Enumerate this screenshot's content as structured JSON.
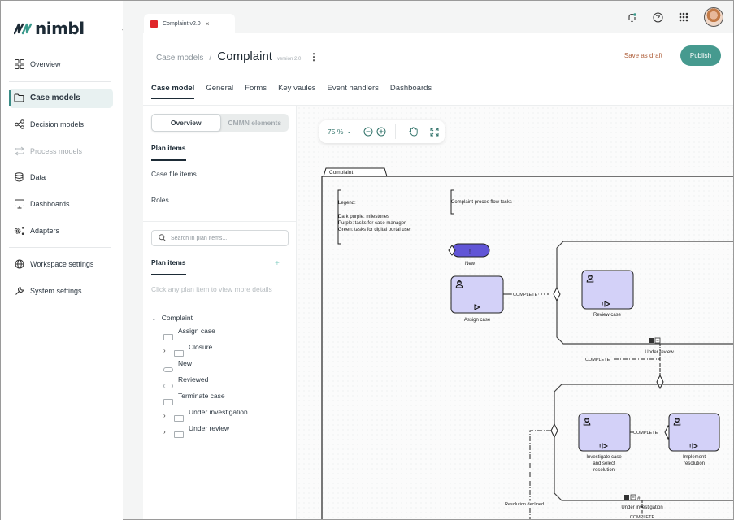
{
  "app": {
    "brand": "nimbl",
    "colors": {
      "accent": "#469a8f",
      "draft": "#b0623e",
      "milestone": "#6155d6",
      "task": "#d3d1f8",
      "tab_marker": "#e0262a"
    }
  },
  "sidebar": {
    "collapse_icon": "chevron-left-icon",
    "items": [
      {
        "label": "Overview",
        "icon": "grid-icon"
      },
      {
        "label": "Case models",
        "icon": "folder-icon",
        "active": true
      },
      {
        "label": "Decision models",
        "icon": "share-icon"
      },
      {
        "label": "Process models",
        "icon": "process-icon",
        "disabled": true
      },
      {
        "label": "Data",
        "icon": "database-icon"
      },
      {
        "label": "Dashboards",
        "icon": "monitor-icon"
      },
      {
        "label": "Adapters",
        "icon": "gear-nodes-icon"
      },
      {
        "label": "Workspace settings",
        "icon": "globe-icon"
      },
      {
        "label": "System settings",
        "icon": "wrench-icon"
      }
    ]
  },
  "topbar": {
    "open_tab": {
      "label": "Complaint v2.0",
      "close": "×"
    },
    "icons": [
      "bell-icon",
      "help-icon",
      "apps-grid-icon",
      "user-avatar"
    ]
  },
  "header": {
    "breadcrumb_parent": "Case models",
    "separator": "/",
    "title": "Complaint",
    "version": "version 2.0",
    "more": "⋮",
    "save_draft": "Save as draft",
    "publish": "Publish"
  },
  "tabs": [
    {
      "label": "Case model",
      "active": true
    },
    {
      "label": "General"
    },
    {
      "label": "Forms"
    },
    {
      "label": "Key vaules"
    },
    {
      "label": "Event handlers"
    },
    {
      "label": "Dashboards"
    }
  ],
  "left_panel": {
    "segments": [
      {
        "label": "Overview",
        "active": true
      },
      {
        "label": "CMMN elements"
      }
    ],
    "sub_nav": [
      {
        "label": "Plan items",
        "active": true
      },
      {
        "label": "Case file items"
      },
      {
        "label": "Roles"
      }
    ],
    "search_placeholder": "Search in plan items...",
    "plan_items_title": "Plan items",
    "add": "+",
    "hint": "Click any plan item to view more details",
    "tree": {
      "root": "Complaint",
      "children": [
        {
          "label": "Assign case",
          "type": "task",
          "expandable": false
        },
        {
          "label": "Closure",
          "type": "stage",
          "expandable": true
        },
        {
          "label": "New",
          "type": "milestone",
          "expandable": false
        },
        {
          "label": "Reviewed",
          "type": "milestone",
          "expandable": false
        },
        {
          "label": "Terminate case",
          "type": "task",
          "expandable": false
        },
        {
          "label": "Under investigation",
          "type": "stage",
          "expandable": true
        },
        {
          "label": "Under review",
          "type": "stage",
          "expandable": true
        }
      ]
    }
  },
  "canvas": {
    "zoom_level": "75 %",
    "tools": [
      "zoom-out-icon",
      "zoom-in-icon",
      "pan-hand-icon",
      "fit-screen-icon"
    ],
    "diagram": {
      "case_plan": "Complaint",
      "legend": {
        "title": "Legend:",
        "lines": [
          "Dark purple: milestones",
          "Purple: tasks for case manager",
          "Green: tasks for digital portal user"
        ]
      },
      "annotation": "Complaint proces flow tasks",
      "milestone": {
        "label": "New",
        "marker": "!"
      },
      "tasks": {
        "assign": "Assign case",
        "review": "Review case",
        "investigate": [
          "Investigate case",
          "and select",
          "resolution"
        ],
        "implement": [
          "Implement",
          "resolution"
        ]
      },
      "stages": {
        "review": "Under review",
        "investigation": "Under investigation"
      },
      "connector_labels": {
        "complete_1": "COMPLETE",
        "complete_2": "COMPLETE",
        "complete_3": "COMPLETE",
        "complete_4": "COMPLETE",
        "declined": "Resolution declined"
      }
    }
  }
}
